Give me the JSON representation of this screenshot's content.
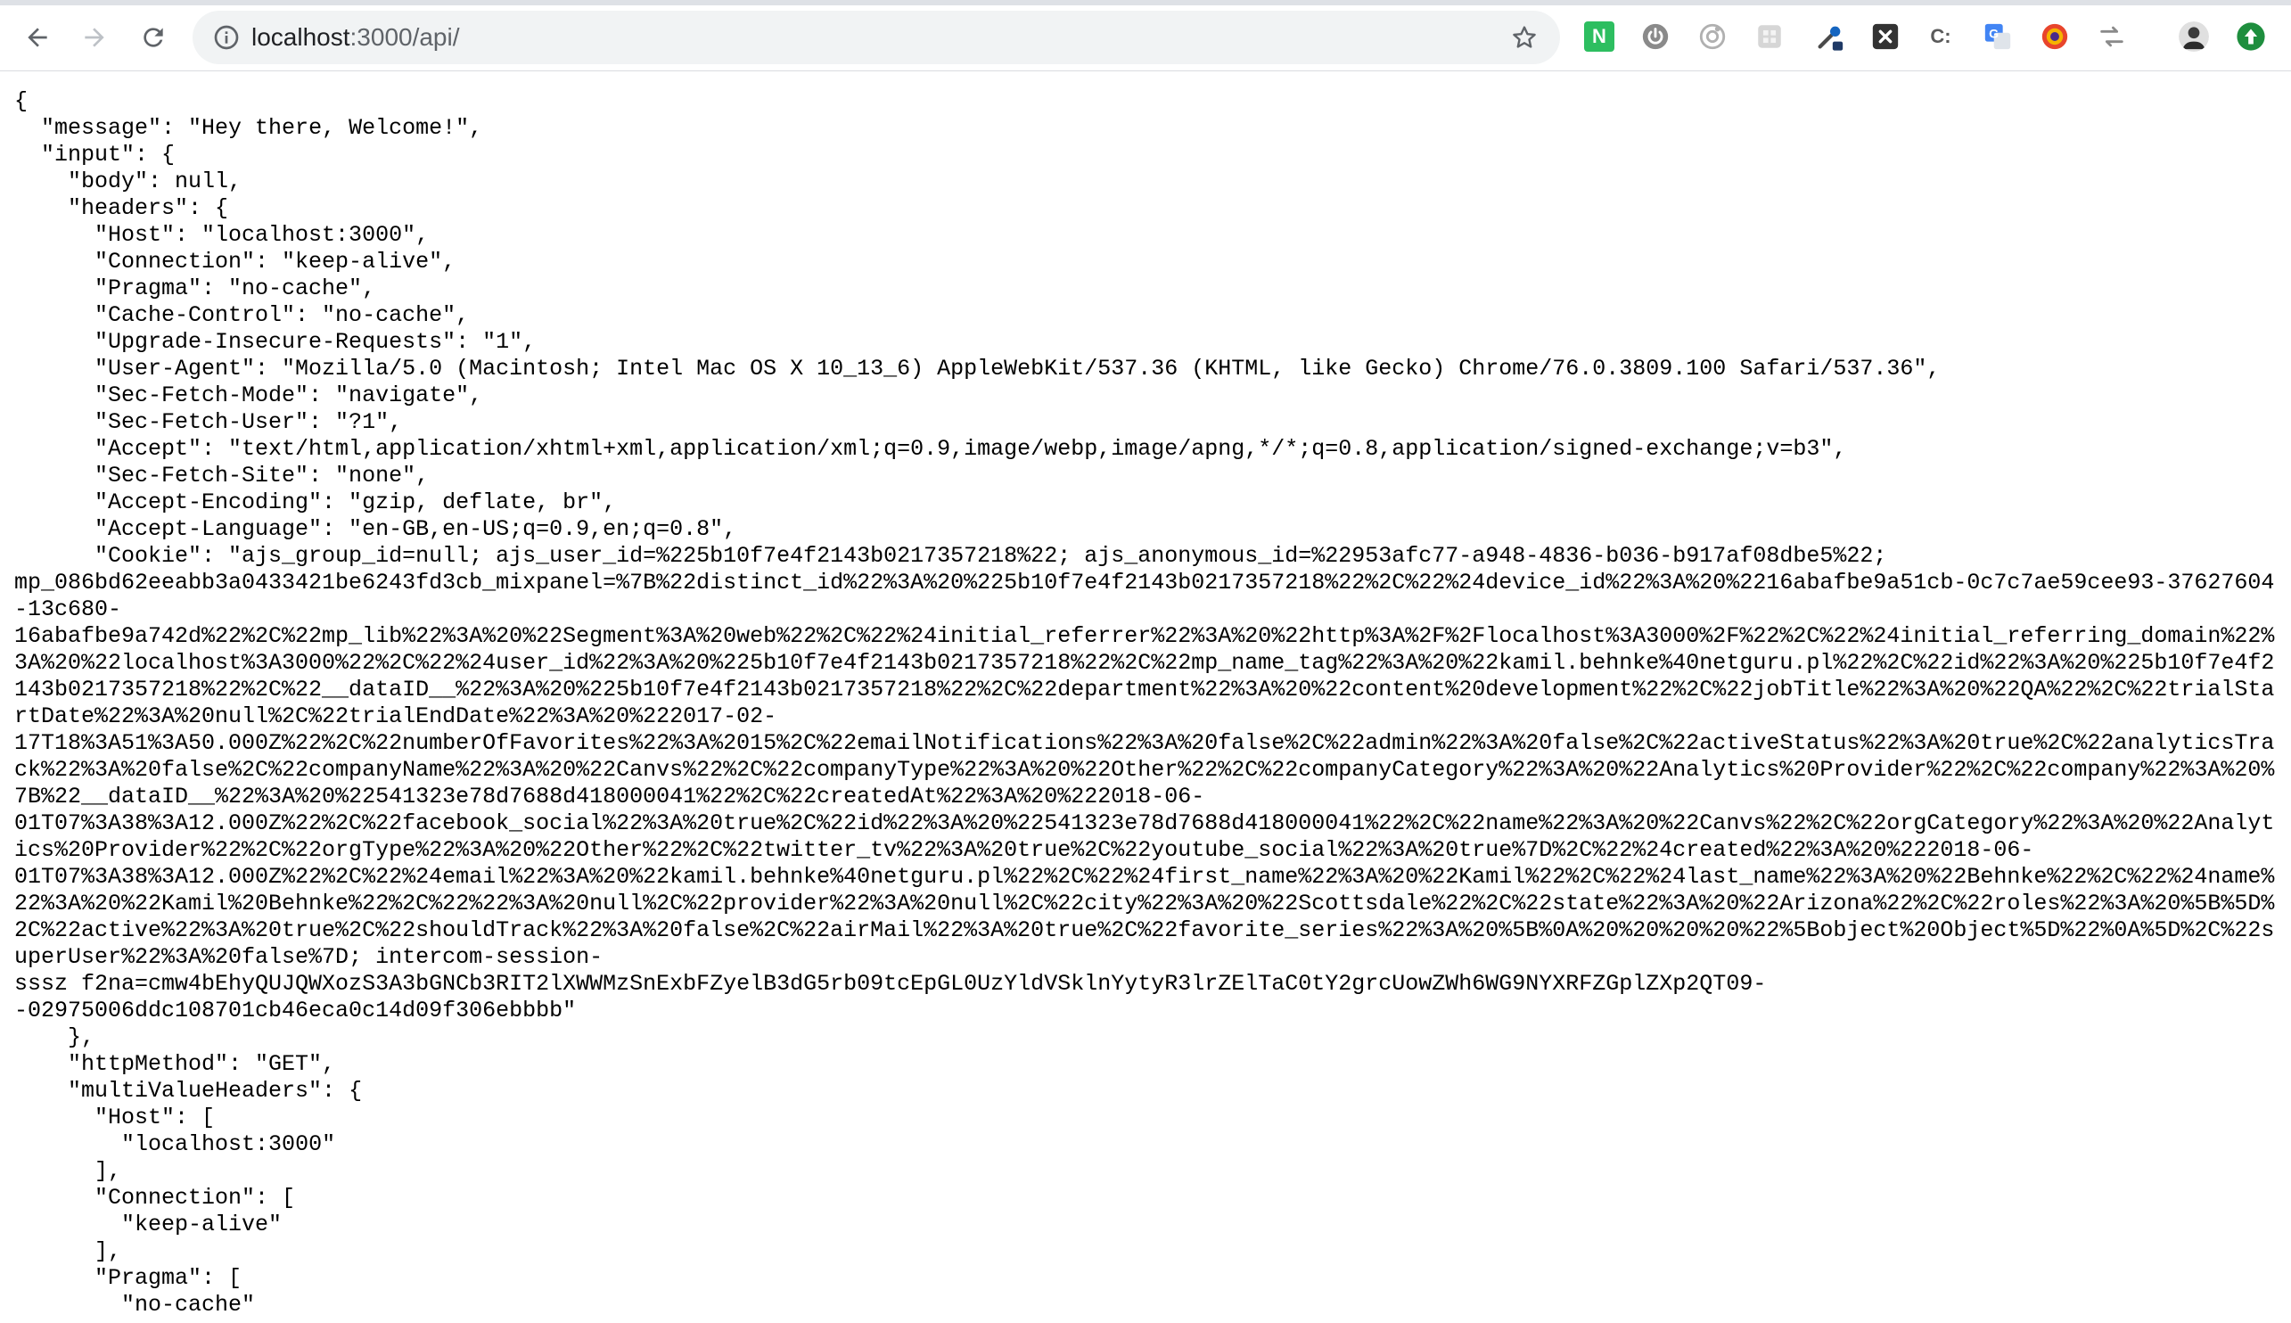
{
  "browser": {
    "url_host": "localhost",
    "url_rest": ":3000/api/",
    "extension_icons": [
      "evernote-icon",
      "power-icon",
      "target-icon",
      "grid-icon",
      "eyedropper-icon",
      "x-icon",
      "ci-icon",
      "translate-icon",
      "color-picker-icon",
      "shuffle-icon",
      "profile-avatar",
      "update-icon"
    ]
  },
  "body": {
    "json_text": "{\n  \"message\": \"Hey there, Welcome!\",\n  \"input\": {\n    \"body\": null,\n    \"headers\": {\n      \"Host\": \"localhost:3000\",\n      \"Connection\": \"keep-alive\",\n      \"Pragma\": \"no-cache\",\n      \"Cache-Control\": \"no-cache\",\n      \"Upgrade-Insecure-Requests\": \"1\",\n      \"User-Agent\": \"Mozilla/5.0 (Macintosh; Intel Mac OS X 10_13_6) AppleWebKit/537.36 (KHTML, like Gecko) Chrome/76.0.3809.100 Safari/537.36\",\n      \"Sec-Fetch-Mode\": \"navigate\",\n      \"Sec-Fetch-User\": \"?1\",\n      \"Accept\": \"text/html,application/xhtml+xml,application/xml;q=0.9,image/webp,image/apng,*/*;q=0.8,application/signed-exchange;v=b3\",\n      \"Sec-Fetch-Site\": \"none\",\n      \"Accept-Encoding\": \"gzip, deflate, br\",\n      \"Accept-Language\": \"en-GB,en-US;q=0.9,en;q=0.8\",\n      \"Cookie\": \"ajs_group_id=null; ajs_user_id=%225b10f7e4f2143b0217357218%22; ajs_anonymous_id=%22953afc77-a948-4836-b036-b917af08dbe5%22;\nmp_086bd62eeabb3a0433421be6243fd3cb_mixpanel=%7B%22distinct_id%22%3A%20%225b10f7e4f2143b0217357218%22%2C%22%24device_id%22%3A%20%2216abafbe9a51cb-0c7c7ae59cee93-37627604-13c680-\n16abafbe9a742d%22%2C%22mp_lib%22%3A%20%22Segment%3A%20web%22%2C%22%24initial_referrer%22%3A%20%22http%3A%2F%2Flocalhost%3A3000%2F%22%2C%22%24initial_referring_domain%22%3A%20%22localhost%3A3000%22%2C%22%24user_id%22%3A%20%225b10f7e4f2143b0217357218%22%2C%22mp_name_tag%22%3A%20%22kamil.behnke%40netguru.pl%22%2C%22id%22%3A%20%225b10f7e4f2143b0217357218%22%2C%22__dataID__%22%3A%20%225b10f7e4f2143b0217357218%22%2C%22department%22%3A%20%22content%20development%22%2C%22jobTitle%22%3A%20%22QA%22%2C%22trialStartDate%22%3A%20null%2C%22trialEndDate%22%3A%20%222017-02-\n17T18%3A51%3A50.000Z%22%2C%22numberOfFavorites%22%3A%2015%2C%22emailNotifications%22%3A%20false%2C%22admin%22%3A%20false%2C%22activeStatus%22%3A%20true%2C%22analyticsTrack%22%3A%20false%2C%22companyName%22%3A%20%22Canvs%22%2C%22companyType%22%3A%20%22Other%22%2C%22companyCategory%22%3A%20%22Analytics%20Provider%22%2C%22company%22%3A%20%7B%22__dataID__%22%3A%20%22541323e78d7688d418000041%22%2C%22createdAt%22%3A%20%222018-06-\n01T07%3A38%3A12.000Z%22%2C%22facebook_social%22%3A%20true%2C%22id%22%3A%20%22541323e78d7688d418000041%22%2C%22name%22%3A%20%22Canvs%22%2C%22orgCategory%22%3A%20%22Analytics%20Provider%22%2C%22orgType%22%3A%20%22Other%22%2C%22twitter_tv%22%3A%20true%2C%22youtube_social%22%3A%20true%7D%2C%22%24created%22%3A%20%222018-06-\n01T07%3A38%3A12.000Z%22%2C%22%24email%22%3A%20%22kamil.behnke%40netguru.pl%22%2C%22%24first_name%22%3A%20%22Kamil%22%2C%22%24last_name%22%3A%20%22Behnke%22%2C%22%24name%22%3A%20%22Kamil%20Behnke%22%2C%22%22%3A%20null%2C%22provider%22%3A%20null%2C%22city%22%3A%20%22Scottsdale%22%2C%22state%22%3A%20%22Arizona%22%2C%22roles%22%3A%20%5B%5D%2C%22active%22%3A%20true%2C%22shouldTrack%22%3A%20false%2C%22airMail%22%3A%20true%2C%22favorite_series%22%3A%20%5B%0A%20%20%20%20%22%5Bobject%20Object%5D%22%0A%5D%2C%22superUser%22%3A%20false%7D; intercom-session-\nsssz f2na=cmw4bEhyQUJQWXozS3A3bGNCb3RIT2lXWWMzSnExbFZyelB3dG5rb09tcEpGL0UzYldVSklnYytyR3lrZElTaC0tY2grcUowZWh6WG9NYXRFZGplZXp2QT09-\n-02975006ddc108701cb46eca0c14d09f306ebbbb\"\n    },\n    \"httpMethod\": \"GET\",\n    \"multiValueHeaders\": {\n      \"Host\": [\n        \"localhost:3000\"\n      ],\n      \"Connection\": [\n        \"keep-alive\"\n      ],\n      \"Pragma\": [\n        \"no-cache\""
  }
}
